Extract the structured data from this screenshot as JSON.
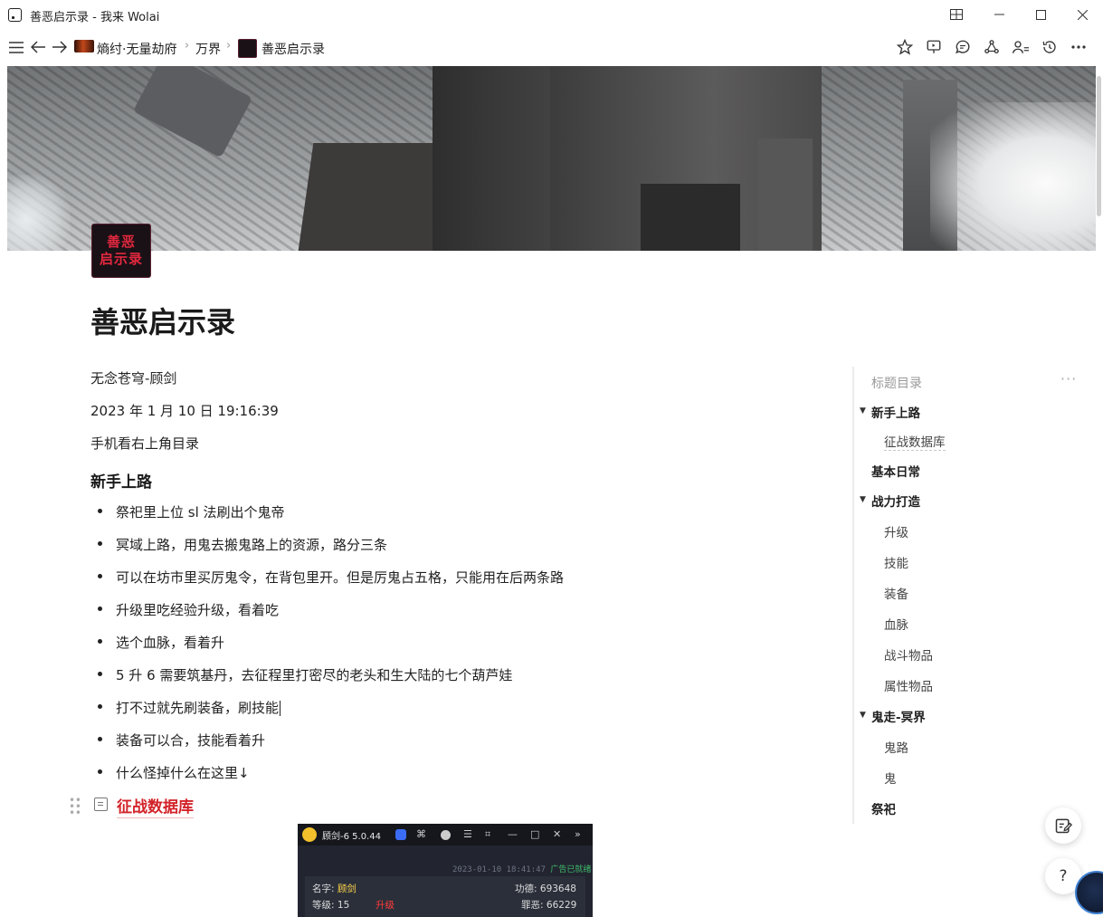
{
  "window": {
    "title": "善恶启示录 - 我来 Wolai",
    "controls": [
      "grid-icon",
      "minimize-icon",
      "maximize-icon",
      "close-icon"
    ]
  },
  "nav": {
    "breadcrumbs": [
      "熵纣·无量劫府",
      "万界",
      "善恶启示录"
    ],
    "toolbar_icons": [
      "star-icon",
      "presentation-icon",
      "comment-icon",
      "share-network-icon",
      "collaborators-icon",
      "history-icon",
      "more-icon"
    ]
  },
  "page": {
    "icon_text": [
      "善恶",
      "启示录"
    ],
    "title": "善恶启示录",
    "author": "无念苍穹-顾剑",
    "datetime": "2023 年 1 月 10 日 19:16:39",
    "mobile_hint": "手机看右上角目录",
    "section_heading": "新手上路",
    "bullets": [
      "祭祀里上位 sl 法刷出个鬼帝",
      "冥域上路，用鬼去搬鬼路上的资源，路分三条",
      "可以在坊市里买厉鬼令，在背包里开。但是厉鬼占五格，只能用在后两条路",
      "升级里吃经验升级，看着吃",
      "选个血脉，看着升",
      "5 升 6 需要筑基丹，去征程里打密尽的老头和生大陆的七个葫芦娃",
      "打不过就先刷装备，刷技能",
      "装备可以合，技能看着升",
      "什么怪掉什么在这里↓"
    ],
    "database_link": "征战数据库"
  },
  "embedded_screenshot": {
    "title": "顾剑-6 5.0.44",
    "timestamp": "2023-01-10 18:41:47",
    "status": "广告已就绪",
    "name_label": "名字:",
    "name_value": "顾剑",
    "merit_label": "功德:",
    "merit_value": "693648",
    "level_label": "等级:",
    "level_value": "15",
    "upgrade_label": "升级",
    "sin_label": "罪恶:",
    "sin_value": "66229"
  },
  "outline": {
    "heading": "标题目录",
    "items": [
      {
        "label": "新手上路",
        "level": 1,
        "collapsible": true
      },
      {
        "label": "征战数据库",
        "level": 2
      },
      {
        "label": "基本日常",
        "level": 1
      },
      {
        "label": "战力打造",
        "level": 1,
        "collapsible": true
      },
      {
        "label": "升级",
        "level": 2
      },
      {
        "label": "技能",
        "level": 2
      },
      {
        "label": "装备",
        "level": 2
      },
      {
        "label": "血脉",
        "level": 2
      },
      {
        "label": "战斗物品",
        "level": 2
      },
      {
        "label": "属性物品",
        "level": 2
      },
      {
        "label": "鬼走-冥界",
        "level": 1,
        "collapsible": true
      },
      {
        "label": "鬼路",
        "level": 2
      },
      {
        "label": "鬼",
        "level": 2
      },
      {
        "label": "祭祀",
        "level": 1
      }
    ]
  },
  "floating": {
    "help_label": "?"
  },
  "colors": {
    "link_red": "#d3232a",
    "icon_red": "#e2283f"
  }
}
